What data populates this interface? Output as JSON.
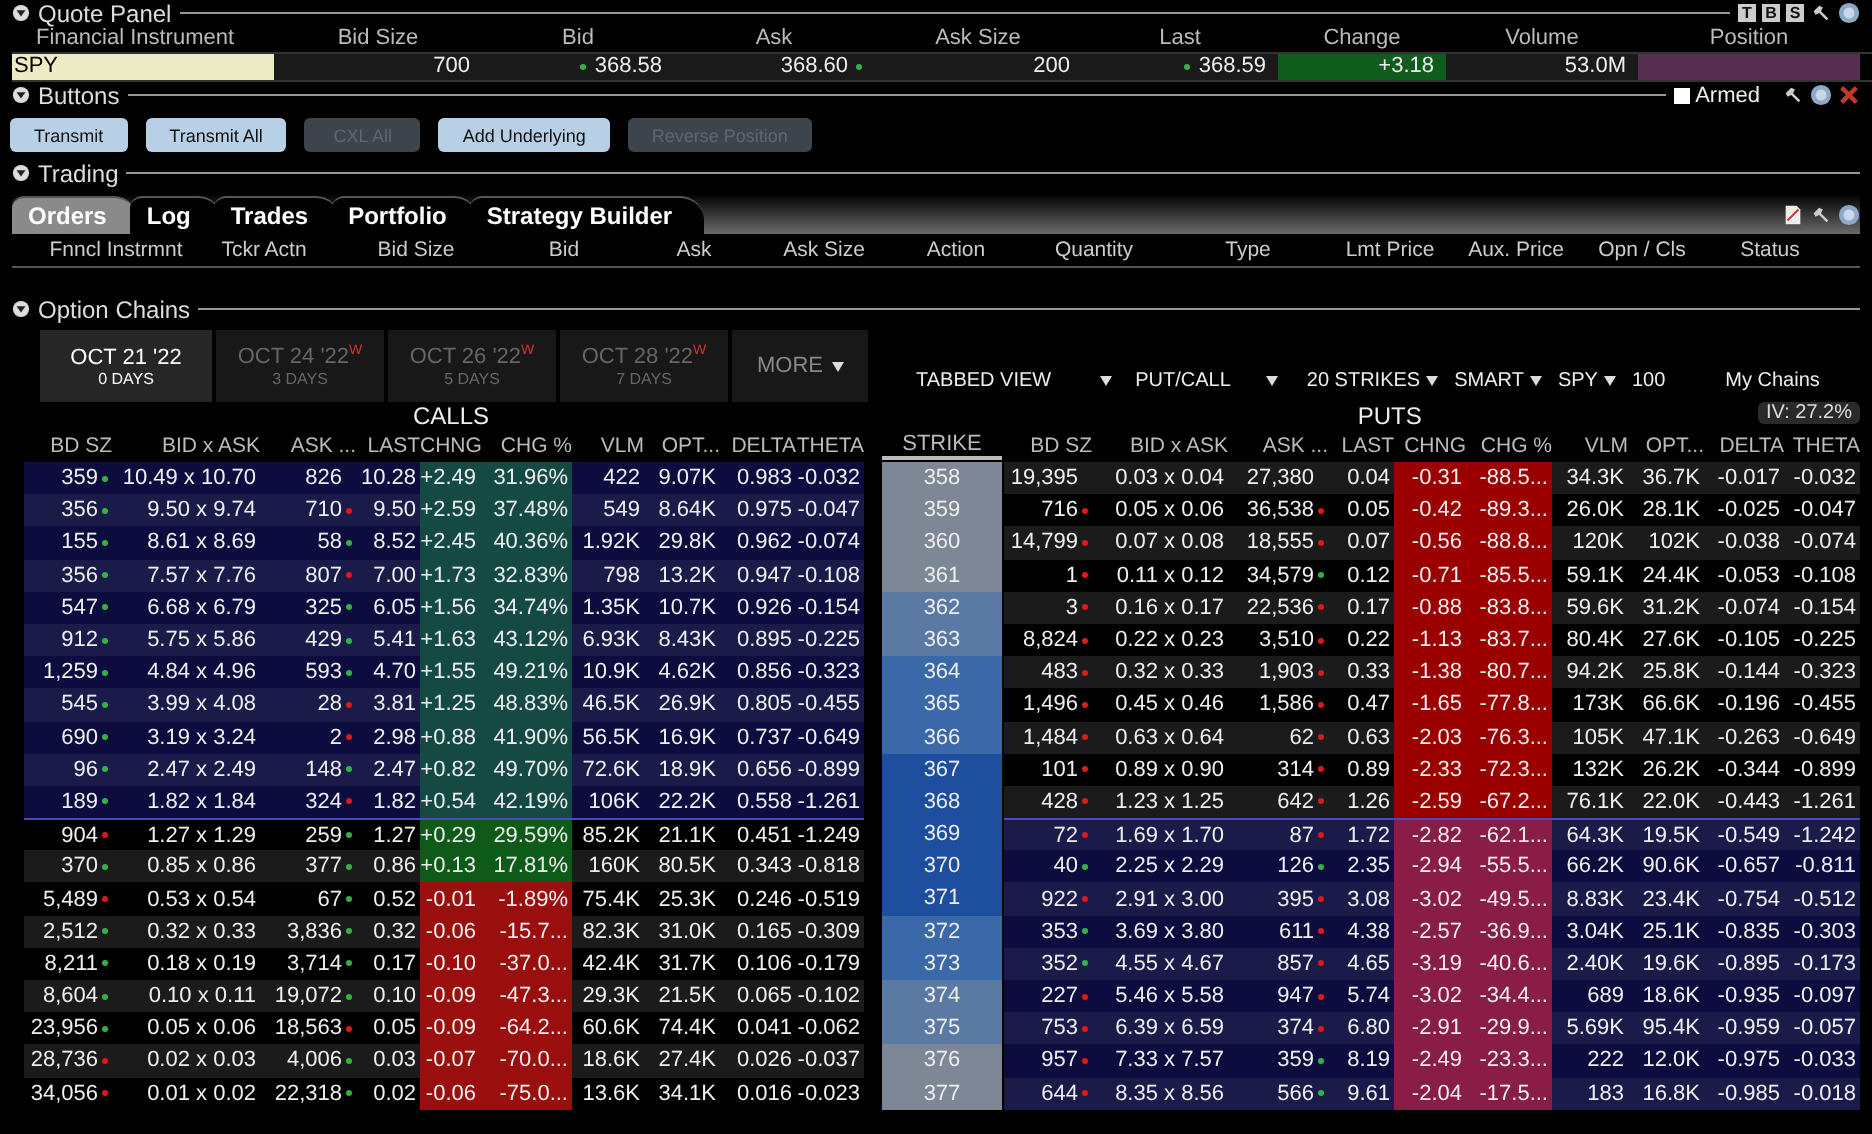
{
  "quote_panel": {
    "title": "Quote Panel",
    "toolbar_buttons": [
      "T",
      "B",
      "S"
    ],
    "columns": [
      "Financial Instrument",
      "Bid Size",
      "Bid",
      "Ask",
      "Ask Size",
      "Last",
      "Change",
      "Volume",
      "Position"
    ],
    "cells": [
      {
        "kind": "symbol",
        "text": "SPY"
      },
      {
        "kind": "plain",
        "text": "700"
      },
      {
        "kind": "leftdot",
        "text": "368.58",
        "up": true
      },
      {
        "kind": "rightdot",
        "text": "368.60",
        "up": true
      },
      {
        "kind": "plain",
        "text": "200"
      },
      {
        "kind": "leftdot",
        "text": "368.59",
        "up": true
      },
      {
        "kind": "change",
        "text": "+3.18",
        "gain": true
      },
      {
        "kind": "plain",
        "text": "53.0M"
      },
      {
        "kind": "position"
      }
    ]
  },
  "buttons_panel": {
    "title": "Buttons",
    "armed": {
      "label": "Armed",
      "checked": false
    },
    "buttons": [
      {
        "label": "Transmit",
        "disabled": false
      },
      {
        "label": "Transmit All",
        "disabled": false
      },
      {
        "label": "CXL All",
        "disabled": true
      },
      {
        "label": "Add Underlying",
        "disabled": false
      },
      {
        "label": "Reverse Position",
        "disabled": true
      }
    ]
  },
  "trading": {
    "title": "Trading",
    "tabs": [
      {
        "label": "Orders",
        "selected": true
      },
      {
        "label": "Log",
        "selected": false
      },
      {
        "label": "Trades",
        "selected": false
      },
      {
        "label": "Portfolio",
        "selected": false
      },
      {
        "label": "Strategy Builder",
        "selected": false
      }
    ],
    "columns": [
      "Fnncl Instrmnt",
      "Tckr Actn",
      "Bid Size",
      "Bid",
      "Ask",
      "Ask Size",
      "Action",
      "Quantity",
      "Type",
      "Lmt Price",
      "Aux. Price",
      "Opn / Cls",
      "Status"
    ]
  },
  "option_chains": {
    "title": "Option Chains",
    "expiries": [
      {
        "date": "OCT 21 '22",
        "days": "0 DAYS",
        "selected": true
      },
      {
        "date": "OCT 24 '22",
        "mark": "W",
        "days": "3 DAYS",
        "selected": false
      },
      {
        "date": "OCT 26 '22",
        "mark": "W",
        "days": "5 DAYS",
        "selected": false
      },
      {
        "date": "OCT 28 '22",
        "mark": "W",
        "days": "7 DAYS",
        "selected": false
      }
    ],
    "more": "MORE",
    "toolbar": [
      {
        "kind": "dropdown",
        "label": "TABBED VIEW"
      },
      {
        "kind": "dropdown",
        "label": "PUT/CALL"
      },
      {
        "kind": "dropdown",
        "label": "20 STRIKES"
      },
      {
        "kind": "dropdown",
        "label": "SMART"
      },
      {
        "kind": "dropdown",
        "label": "SPY"
      },
      {
        "kind": "text",
        "label": "100"
      },
      {
        "kind": "text",
        "label": "My Chains"
      }
    ],
    "iv": "IV: 27.2%",
    "calls_label": "CALLS",
    "puts_label": "PUTS",
    "strike_label": "STRIKE",
    "call_headers": [
      "BD SZ",
      "BID x ASK",
      "ASK ...",
      "LAST",
      "CHNG",
      "CHG %",
      "VLM",
      "OPT...",
      "DELTA",
      "THETA"
    ],
    "put_headers": [
      "BD SZ",
      "BID x ASK",
      "ASK ...",
      "LAST",
      "CHNG",
      "CHG %",
      "VLM",
      "OPT...",
      "DELTA",
      "THETA"
    ],
    "rows": [
      {
        "strike": "358",
        "color": "#7d8796",
        "call": {
          "in_the_money": true,
          "gain": true,
          "bd_sz": "359",
          "bd_up": true,
          "bid_ask": "10.49 x 10.70",
          "ask_sz": "826",
          "last": "10.28",
          "chng": "+2.49",
          "chg_pct": "31.96%",
          "vlm": "422",
          "opt": "9.07K",
          "delta": "0.983",
          "theta": "-0.032"
        },
        "put": {
          "in_the_money": false,
          "gain": false,
          "bd_sz": "19,395",
          "bid_ask": "0.03 x 0.04",
          "ask_sz": "27,380",
          "last": "0.04",
          "chng": "-0.31",
          "chg_pct": "-88.5...",
          "vlm": "34.3K",
          "opt": "36.7K",
          "delta": "-0.017",
          "theta": "-0.032"
        }
      },
      {
        "strike": "359",
        "color": "#7d8796",
        "call": {
          "in_the_money": true,
          "gain": true,
          "bd_sz": "356",
          "bd_up": true,
          "bid_ask": "9.50 x 9.74",
          "ask_sz": "710",
          "ask_up": false,
          "last": "9.50",
          "chng": "+2.59",
          "chg_pct": "37.48%",
          "vlm": "549",
          "opt": "8.64K",
          "delta": "0.975",
          "theta": "-0.047"
        },
        "put": {
          "in_the_money": false,
          "gain": false,
          "bd_sz": "716",
          "bd_up": false,
          "bid_ask": "0.05 x 0.06",
          "ask_sz": "36,538",
          "ask_up": false,
          "last": "0.05",
          "chng": "-0.42",
          "chg_pct": "-89.3...",
          "vlm": "26.0K",
          "opt": "28.1K",
          "delta": "-0.025",
          "theta": "-0.047"
        }
      },
      {
        "strike": "360",
        "color": "#7d8796",
        "call": {
          "in_the_money": true,
          "gain": true,
          "bd_sz": "155",
          "bd_up": true,
          "bid_ask": "8.61 x 8.69",
          "ask_sz": "58",
          "ask_up": true,
          "last": "8.52",
          "chng": "+2.45",
          "chg_pct": "40.36%",
          "vlm": "1.92K",
          "opt": "29.8K",
          "delta": "0.962",
          "theta": "-0.074"
        },
        "put": {
          "in_the_money": false,
          "gain": false,
          "bd_sz": "14,799",
          "bd_up": false,
          "bid_ask": "0.07 x 0.08",
          "ask_sz": "18,555",
          "ask_up": false,
          "last": "0.07",
          "chng": "-0.56",
          "chg_pct": "-88.8...",
          "vlm": "120K",
          "opt": "102K",
          "delta": "-0.038",
          "theta": "-0.074"
        }
      },
      {
        "strike": "361",
        "color": "#7d8796",
        "call": {
          "in_the_money": true,
          "gain": true,
          "bd_sz": "356",
          "bd_up": true,
          "bid_ask": "7.57 x 7.76",
          "ask_sz": "807",
          "ask_up": false,
          "last": "7.00",
          "chng": "+1.73",
          "chg_pct": "32.83%",
          "vlm": "798",
          "opt": "13.2K",
          "delta": "0.947",
          "theta": "-0.108"
        },
        "put": {
          "in_the_money": false,
          "gain": false,
          "bd_sz": "1",
          "bd_up": false,
          "bid_ask": "0.11 x 0.12",
          "ask_sz": "34,579",
          "ask_up": true,
          "last": "0.12",
          "chng": "-0.71",
          "chg_pct": "-85.5...",
          "vlm": "59.1K",
          "opt": "24.4K",
          "delta": "-0.053",
          "theta": "-0.108"
        }
      },
      {
        "strike": "362",
        "color": "#5a7aa3",
        "call": {
          "in_the_money": true,
          "gain": true,
          "bd_sz": "547",
          "bd_up": true,
          "bid_ask": "6.68 x 6.79",
          "ask_sz": "325",
          "ask_up": true,
          "last": "6.05",
          "chng": "+1.56",
          "chg_pct": "34.74%",
          "vlm": "1.35K",
          "opt": "10.7K",
          "delta": "0.926",
          "theta": "-0.154"
        },
        "put": {
          "in_the_money": false,
          "gain": false,
          "bd_sz": "3",
          "bd_up": false,
          "bid_ask": "0.16 x 0.17",
          "ask_sz": "22,536",
          "ask_up": false,
          "last": "0.17",
          "chng": "-0.88",
          "chg_pct": "-83.8...",
          "vlm": "59.6K",
          "opt": "31.2K",
          "delta": "-0.074",
          "theta": "-0.154"
        }
      },
      {
        "strike": "363",
        "color": "#5a7aa3",
        "call": {
          "in_the_money": true,
          "gain": true,
          "bd_sz": "912",
          "bd_up": true,
          "bid_ask": "5.75 x 5.86",
          "ask_sz": "429",
          "ask_up": true,
          "last": "5.41",
          "chng": "+1.63",
          "chg_pct": "43.12%",
          "vlm": "6.93K",
          "opt": "8.43K",
          "delta": "0.895",
          "theta": "-0.225"
        },
        "put": {
          "in_the_money": false,
          "gain": false,
          "bd_sz": "8,824",
          "bd_up": false,
          "bid_ask": "0.22 x 0.23",
          "ask_sz": "3,510",
          "ask_up": false,
          "last": "0.22",
          "chng": "-1.13",
          "chg_pct": "-83.7...",
          "vlm": "80.4K",
          "opt": "27.6K",
          "delta": "-0.105",
          "theta": "-0.225"
        }
      },
      {
        "strike": "364",
        "color": "#3b68a8",
        "call": {
          "in_the_money": true,
          "gain": true,
          "bd_sz": "1,259",
          "bd_up": true,
          "bid_ask": "4.84 x 4.96",
          "ask_sz": "593",
          "ask_up": true,
          "last": "4.70",
          "chng": "+1.55",
          "chg_pct": "49.21%",
          "vlm": "10.9K",
          "opt": "4.62K",
          "delta": "0.856",
          "theta": "-0.323"
        },
        "put": {
          "in_the_money": false,
          "gain": false,
          "bd_sz": "483",
          "bd_up": false,
          "bid_ask": "0.32 x 0.33",
          "ask_sz": "1,903",
          "ask_up": false,
          "last": "0.33",
          "chng": "-1.38",
          "chg_pct": "-80.7...",
          "vlm": "94.2K",
          "opt": "25.8K",
          "delta": "-0.144",
          "theta": "-0.323"
        }
      },
      {
        "strike": "365",
        "color": "#3b68a8",
        "call": {
          "in_the_money": true,
          "gain": true,
          "bd_sz": "545",
          "bd_up": true,
          "bid_ask": "3.99 x 4.08",
          "ask_sz": "28",
          "ask_up": false,
          "last": "3.81",
          "chng": "+1.25",
          "chg_pct": "48.83%",
          "vlm": "46.5K",
          "opt": "26.9K",
          "delta": "0.805",
          "theta": "-0.455"
        },
        "put": {
          "in_the_money": false,
          "gain": false,
          "bd_sz": "1,496",
          "bd_up": false,
          "bid_ask": "0.45 x 0.46",
          "ask_sz": "1,586",
          "ask_up": false,
          "last": "0.47",
          "chng": "-1.65",
          "chg_pct": "-77.8...",
          "vlm": "173K",
          "opt": "66.6K",
          "delta": "-0.196",
          "theta": "-0.455"
        }
      },
      {
        "strike": "366",
        "color": "#3b68a8",
        "call": {
          "in_the_money": true,
          "gain": true,
          "bd_sz": "690",
          "bd_up": true,
          "bid_ask": "3.19 x 3.24",
          "ask_sz": "2",
          "ask_up": false,
          "last": "2.98",
          "chng": "+0.88",
          "chg_pct": "41.90%",
          "vlm": "56.5K",
          "opt": "16.9K",
          "delta": "0.737",
          "theta": "-0.649"
        },
        "put": {
          "in_the_money": false,
          "gain": false,
          "bd_sz": "1,484",
          "bd_up": false,
          "bid_ask": "0.63 x 0.64",
          "ask_sz": "62",
          "ask_up": false,
          "last": "0.63",
          "chng": "-2.03",
          "chg_pct": "-76.3...",
          "vlm": "105K",
          "opt": "47.1K",
          "delta": "-0.263",
          "theta": "-0.649"
        }
      },
      {
        "strike": "367",
        "color": "#1e4f9f",
        "call": {
          "in_the_money": true,
          "gain": true,
          "bd_sz": "96",
          "bd_up": true,
          "bid_ask": "2.47 x 2.49",
          "ask_sz": "148",
          "ask_up": true,
          "last": "2.47",
          "chng": "+0.82",
          "chg_pct": "49.70%",
          "vlm": "72.6K",
          "opt": "18.9K",
          "delta": "0.656",
          "theta": "-0.899"
        },
        "put": {
          "in_the_money": false,
          "gain": false,
          "bd_sz": "101",
          "bd_up": false,
          "bid_ask": "0.89 x 0.90",
          "ask_sz": "314",
          "ask_up": false,
          "last": "0.89",
          "chng": "-2.33",
          "chg_pct": "-72.3...",
          "vlm": "132K",
          "opt": "26.2K",
          "delta": "-0.344",
          "theta": "-0.899"
        }
      },
      {
        "strike": "368",
        "color": "#1e4f9f",
        "call": {
          "in_the_money": true,
          "gain": true,
          "bd_sz": "189",
          "bd_up": true,
          "bid_ask": "1.82 x 1.84",
          "ask_sz": "324",
          "ask_up": false,
          "last": "1.82",
          "chng": "+0.54",
          "chg_pct": "42.19%",
          "vlm": "106K",
          "opt": "22.2K",
          "delta": "0.558",
          "theta": "-1.261"
        },
        "put": {
          "in_the_money": false,
          "gain": false,
          "bd_sz": "428",
          "bd_up": false,
          "bid_ask": "1.23 x 1.25",
          "ask_sz": "642",
          "ask_up": false,
          "last": "1.26",
          "chng": "-2.59",
          "chg_pct": "-67.2...",
          "vlm": "76.1K",
          "opt": "22.0K",
          "delta": "-0.443",
          "theta": "-1.261"
        }
      },
      {
        "strike": "369",
        "color": "#1e4f9f",
        "call": {
          "in_the_money": false,
          "gain": true,
          "bd_sz": "904",
          "bd_up": false,
          "bid_ask": "1.27 x 1.29",
          "ask_sz": "259",
          "ask_up": true,
          "last": "1.27",
          "chng": "+0.29",
          "chg_pct": "29.59%",
          "vlm": "85.2K",
          "opt": "21.1K",
          "delta": "0.451",
          "theta": "-1.249"
        },
        "put": {
          "in_the_money": true,
          "gain": false,
          "bd_sz": "72",
          "bd_up": false,
          "bid_ask": "1.69 x 1.70",
          "ask_sz": "87",
          "ask_up": false,
          "last": "1.72",
          "chng": "-2.82",
          "chg_pct": "-62.1...",
          "vlm": "64.3K",
          "opt": "19.5K",
          "delta": "-0.549",
          "theta": "-1.242"
        }
      },
      {
        "strike": "370",
        "color": "#1e4f9f",
        "call": {
          "in_the_money": false,
          "gain": true,
          "bd_sz": "370",
          "bd_up": true,
          "bid_ask": "0.85 x 0.86",
          "ask_sz": "377",
          "ask_up": true,
          "last": "0.86",
          "chng": "+0.13",
          "chg_pct": "17.81%",
          "vlm": "160K",
          "opt": "80.5K",
          "delta": "0.343",
          "theta": "-0.818"
        },
        "put": {
          "in_the_money": true,
          "gain": false,
          "bd_sz": "40",
          "bd_up": true,
          "bid_ask": "2.25 x 2.29",
          "ask_sz": "126",
          "ask_up": true,
          "last": "2.35",
          "chng": "-2.94",
          "chg_pct": "-55.5...",
          "vlm": "66.2K",
          "opt": "90.6K",
          "delta": "-0.657",
          "theta": "-0.811"
        }
      },
      {
        "strike": "371",
        "color": "#1e4f9f",
        "call": {
          "in_the_money": false,
          "gain": false,
          "bd_sz": "5,489",
          "bd_up": false,
          "bid_ask": "0.53 x 0.54",
          "ask_sz": "67",
          "ask_up": true,
          "last": "0.52",
          "chng": "-0.01",
          "chg_pct": "-1.89%",
          "vlm": "75.4K",
          "opt": "25.3K",
          "delta": "0.246",
          "theta": "-0.519"
        },
        "put": {
          "in_the_money": true,
          "gain": false,
          "bd_sz": "922",
          "bd_up": false,
          "bid_ask": "2.91 x 3.00",
          "ask_sz": "395",
          "ask_up": false,
          "last": "3.08",
          "chng": "-3.02",
          "chg_pct": "-49.5...",
          "vlm": "8.83K",
          "opt": "23.4K",
          "delta": "-0.754",
          "theta": "-0.512"
        }
      },
      {
        "strike": "372",
        "color": "#3b68a8",
        "call": {
          "in_the_money": false,
          "gain": false,
          "bd_sz": "2,512",
          "bd_up": true,
          "bid_ask": "0.32 x 0.33",
          "ask_sz": "3,836",
          "ask_up": true,
          "last": "0.32",
          "chng": "-0.06",
          "chg_pct": "-15.7...",
          "vlm": "82.3K",
          "opt": "31.0K",
          "delta": "0.165",
          "theta": "-0.309"
        },
        "put": {
          "in_the_money": true,
          "gain": false,
          "bd_sz": "353",
          "bd_up": true,
          "bid_ask": "3.69 x 3.80",
          "ask_sz": "611",
          "ask_up": false,
          "last": "4.38",
          "chng": "-2.57",
          "chg_pct": "-36.9...",
          "vlm": "3.04K",
          "opt": "25.1K",
          "delta": "-0.835",
          "theta": "-0.303"
        }
      },
      {
        "strike": "373",
        "color": "#3b68a8",
        "call": {
          "in_the_money": false,
          "gain": false,
          "bd_sz": "8,211",
          "bd_up": true,
          "bid_ask": "0.18 x 0.19",
          "ask_sz": "3,714",
          "ask_up": true,
          "last": "0.17",
          "chng": "-0.10",
          "chg_pct": "-37.0...",
          "vlm": "42.4K",
          "opt": "31.7K",
          "delta": "0.106",
          "theta": "-0.179"
        },
        "put": {
          "in_the_money": true,
          "gain": false,
          "bd_sz": "352",
          "bd_up": true,
          "bid_ask": "4.55 x 4.67",
          "ask_sz": "857",
          "ask_up": false,
          "last": "4.65",
          "chng": "-3.19",
          "chg_pct": "-40.6...",
          "vlm": "2.40K",
          "opt": "19.6K",
          "delta": "-0.895",
          "theta": "-0.173"
        }
      },
      {
        "strike": "374",
        "color": "#5a7aa3",
        "call": {
          "in_the_money": false,
          "gain": false,
          "bd_sz": "8,604",
          "bd_up": true,
          "bid_ask": "0.10 x 0.11",
          "ask_sz": "19,072",
          "ask_up": true,
          "last": "0.10",
          "chng": "-0.09",
          "chg_pct": "-47.3...",
          "vlm": "29.3K",
          "opt": "21.5K",
          "delta": "0.065",
          "theta": "-0.102"
        },
        "put": {
          "in_the_money": true,
          "gain": false,
          "bd_sz": "227",
          "bd_up": false,
          "bid_ask": "5.46 x 5.58",
          "ask_sz": "947",
          "ask_up": false,
          "last": "5.74",
          "chng": "-3.02",
          "chg_pct": "-34.4...",
          "vlm": "689",
          "opt": "18.6K",
          "delta": "-0.935",
          "theta": "-0.097"
        }
      },
      {
        "strike": "375",
        "color": "#5a7aa3",
        "call": {
          "in_the_money": false,
          "gain": false,
          "bd_sz": "23,956",
          "bd_up": true,
          "bid_ask": "0.05 x 0.06",
          "ask_sz": "18,563",
          "ask_up": false,
          "last": "0.05",
          "chng": "-0.09",
          "chg_pct": "-64.2...",
          "vlm": "60.6K",
          "opt": "74.4K",
          "delta": "0.041",
          "theta": "-0.062"
        },
        "put": {
          "in_the_money": true,
          "gain": false,
          "bd_sz": "753",
          "bd_up": false,
          "bid_ask": "6.39 x 6.59",
          "ask_sz": "374",
          "ask_up": false,
          "last": "6.80",
          "chng": "-2.91",
          "chg_pct": "-29.9...",
          "vlm": "5.69K",
          "opt": "95.4K",
          "delta": "-0.959",
          "theta": "-0.057"
        }
      },
      {
        "strike": "376",
        "color": "#7d8796",
        "call": {
          "in_the_money": false,
          "gain": false,
          "bd_sz": "28,736",
          "bd_up": false,
          "bid_ask": "0.02 x 0.03",
          "ask_sz": "4,006",
          "ask_up": true,
          "last": "0.03",
          "chng": "-0.07",
          "chg_pct": "-70.0...",
          "vlm": "18.6K",
          "opt": "27.4K",
          "delta": "0.026",
          "theta": "-0.037"
        },
        "put": {
          "in_the_money": true,
          "gain": false,
          "bd_sz": "957",
          "bd_up": false,
          "bid_ask": "7.33 x 7.57",
          "ask_sz": "359",
          "ask_up": true,
          "last": "8.19",
          "chng": "-2.49",
          "chg_pct": "-23.3...",
          "vlm": "222",
          "opt": "12.0K",
          "delta": "-0.975",
          "theta": "-0.033"
        }
      },
      {
        "strike": "377",
        "color": "#7d8796",
        "call": {
          "in_the_money": false,
          "gain": false,
          "bd_sz": "34,056",
          "bd_up": false,
          "bid_ask": "0.01 x 0.02",
          "ask_sz": "22,318",
          "ask_up": true,
          "last": "0.02",
          "chng": "-0.06",
          "chg_pct": "-75.0...",
          "vlm": "13.6K",
          "opt": "34.1K",
          "delta": "0.016",
          "theta": "-0.023"
        },
        "put": {
          "in_the_money": true,
          "gain": false,
          "bd_sz": "644",
          "bd_up": false,
          "bid_ask": "8.35 x 8.56",
          "ask_sz": "566",
          "ask_up": true,
          "last": "9.61",
          "chng": "-2.04",
          "chg_pct": "-17.5...",
          "vlm": "183",
          "opt": "16.8K",
          "delta": "-0.985",
          "theta": "-0.018"
        }
      }
    ]
  }
}
